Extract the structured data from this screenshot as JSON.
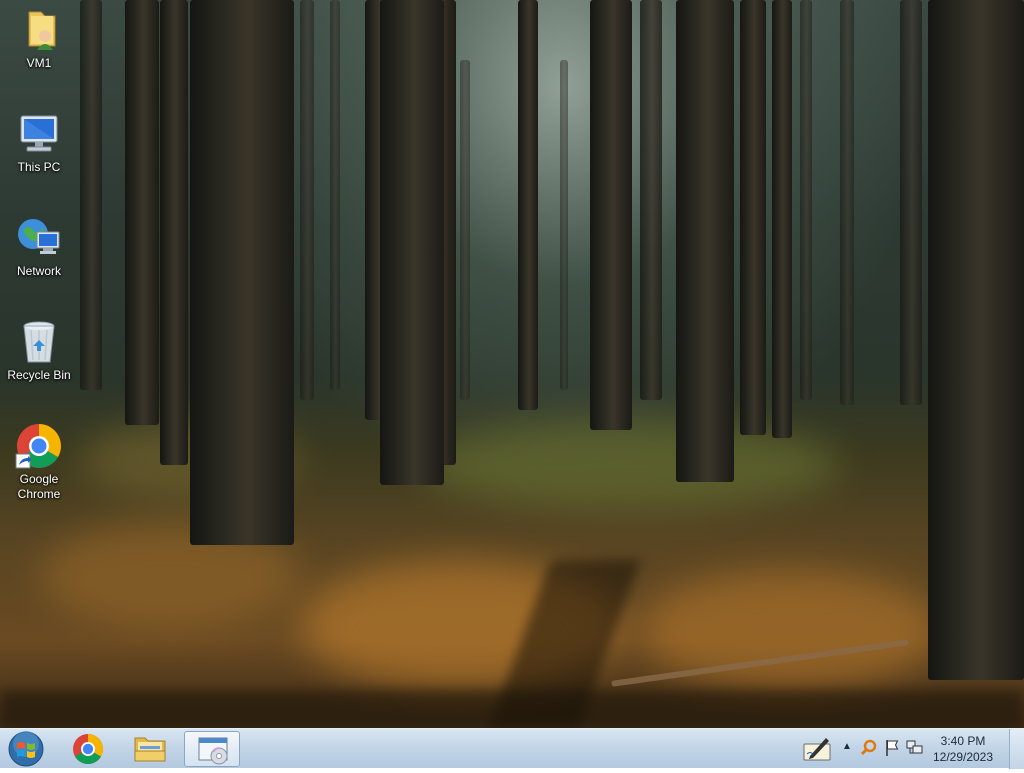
{
  "desktop": {
    "icons": [
      {
        "label": "VM1",
        "icon": "user-folder-icon"
      },
      {
        "label": "This PC",
        "icon": "computer-icon"
      },
      {
        "label": "Network",
        "icon": "network-icon"
      },
      {
        "label": "Recycle Bin",
        "icon": "recycle-bin-icon"
      },
      {
        "label": "Google\nChrome",
        "icon": "chrome-shortcut-icon"
      }
    ]
  },
  "taskbar": {
    "start": {
      "icon": "windows-start-orb-icon"
    },
    "pinned": [
      {
        "icon": "chrome-icon",
        "active": false
      },
      {
        "icon": "file-explorer-icon",
        "active": false
      },
      {
        "icon": "app-window-disc-icon",
        "active": true
      }
    ],
    "tray": {
      "icons": [
        "pen-input-icon",
        "show-hidden-icons-chevron",
        "search-magnifier-icon",
        "action-center-flag-icon",
        "network-status-icon"
      ],
      "time": "3:40 PM",
      "date": "12/29/2023"
    }
  },
  "colors": {
    "taskbar": "#c3d5e8",
    "clock_text": "#1c2b3a"
  }
}
